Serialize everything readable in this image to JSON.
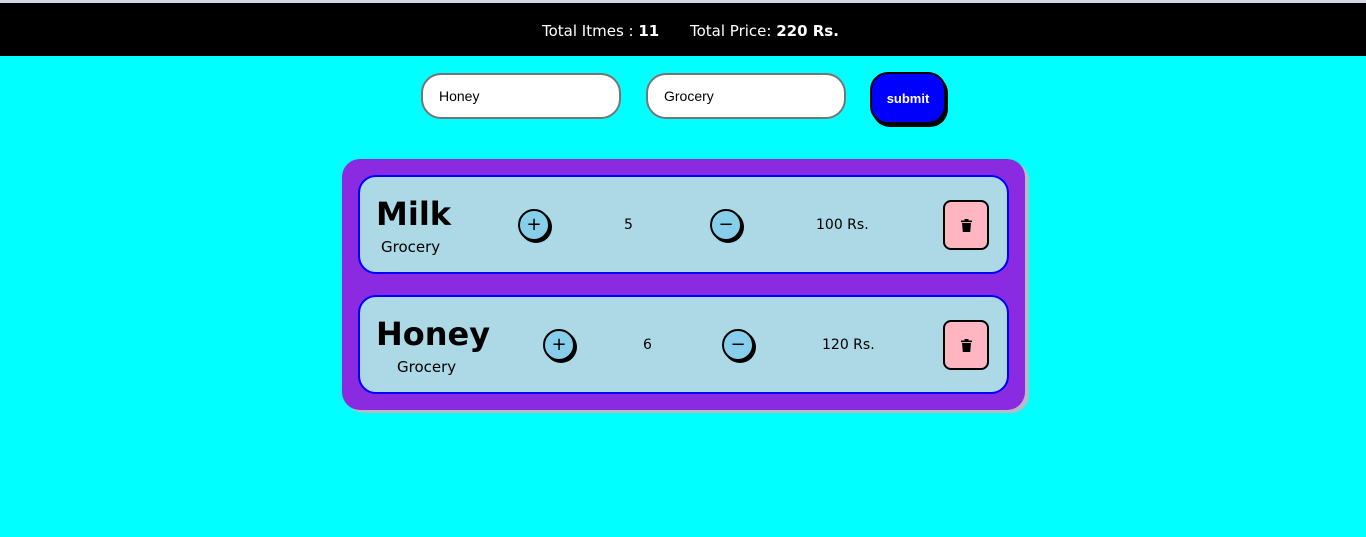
{
  "header": {
    "total_items_label": "Total Itmes : ",
    "total_items_value": "11",
    "total_price_label": "Total Price: ",
    "total_price_value": "220 Rs."
  },
  "form": {
    "name_value": "Honey",
    "category_value": "Grocery",
    "submit_label": "submit"
  },
  "items": [
    {
      "name": "Milk",
      "category": "Grocery",
      "inc_label": "+",
      "quantity": "5",
      "dec_label": "−",
      "price": "100 Rs.",
      "delete_icon": "trash-icon"
    },
    {
      "name": "Honey",
      "category": "Grocery",
      "inc_label": "+",
      "quantity": "6",
      "dec_label": "−",
      "price": "120 Rs.",
      "delete_icon": "trash-icon"
    }
  ],
  "colors": {
    "background": "#00ffff",
    "header": "#000000",
    "cart_panel": "#8a2be2",
    "item_card": "#add8e6",
    "item_border": "#0000ff",
    "submit_button": "#0000ff",
    "qty_button": "#87ceeb",
    "delete_button": "#ffb6c1"
  }
}
